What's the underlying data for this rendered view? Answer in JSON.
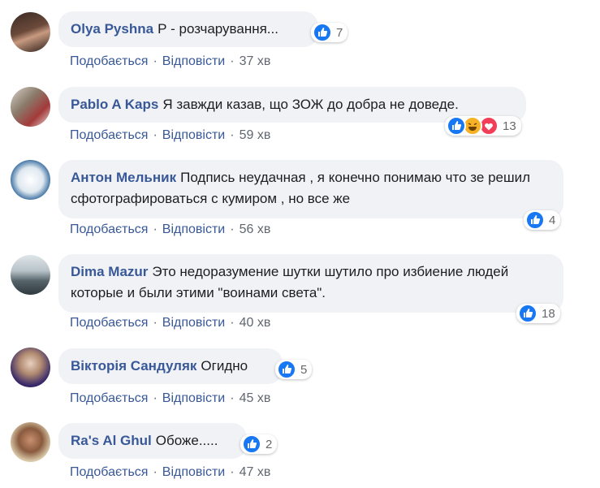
{
  "comments": [
    {
      "author": "Olya Pyshna",
      "text": "Р - розчарування...",
      "reaction_count": "7",
      "like": "Подобається",
      "reply": "Відповісти",
      "time": "37 хв",
      "reactions": [
        "like"
      ]
    },
    {
      "author": "Pablo A Kaps",
      "text": "Я завжди казав, що ЗОЖ до добра не доведе.",
      "reaction_count": "13",
      "like": "Подобається",
      "reply": "Відповісти",
      "time": "59 хв",
      "reactions": [
        "like",
        "haha",
        "love"
      ]
    },
    {
      "author": "Антон Мельник",
      "text": "Подпись неудачная , я конечно понимаю что зе решил сфотографироваться с кумиром , но все же",
      "reaction_count": "4",
      "like": "Подобається",
      "reply": "Відповісти",
      "time": "56 хв",
      "reactions": [
        "like"
      ]
    },
    {
      "author": "Dima Mazur",
      "text": "Это недоразумение шутки шутило про избиение людей которые и были этими \"воинами света\".",
      "reaction_count": "18",
      "like": "Подобається",
      "reply": "Відповісти",
      "time": "40 хв",
      "reactions": [
        "like"
      ]
    },
    {
      "author": "Вікторія Сандуляк",
      "text": "Огидно",
      "reaction_count": "5",
      "like": "Подобається",
      "reply": "Відповісти",
      "time": "45 хв",
      "reactions": [
        "like"
      ]
    },
    {
      "author": "Ra's Al Ghul",
      "text": "Обоже.....",
      "reaction_count": "2",
      "like": "Подобається",
      "reply": "Відповісти",
      "time": "47 хв",
      "reactions": [
        "like"
      ]
    }
  ],
  "colors": {
    "author": "#385898",
    "bubble": "#f0f2f5",
    "like": "#1877f2",
    "haha": "#f7b125",
    "love": "#f33e58",
    "meta": "#606770"
  }
}
